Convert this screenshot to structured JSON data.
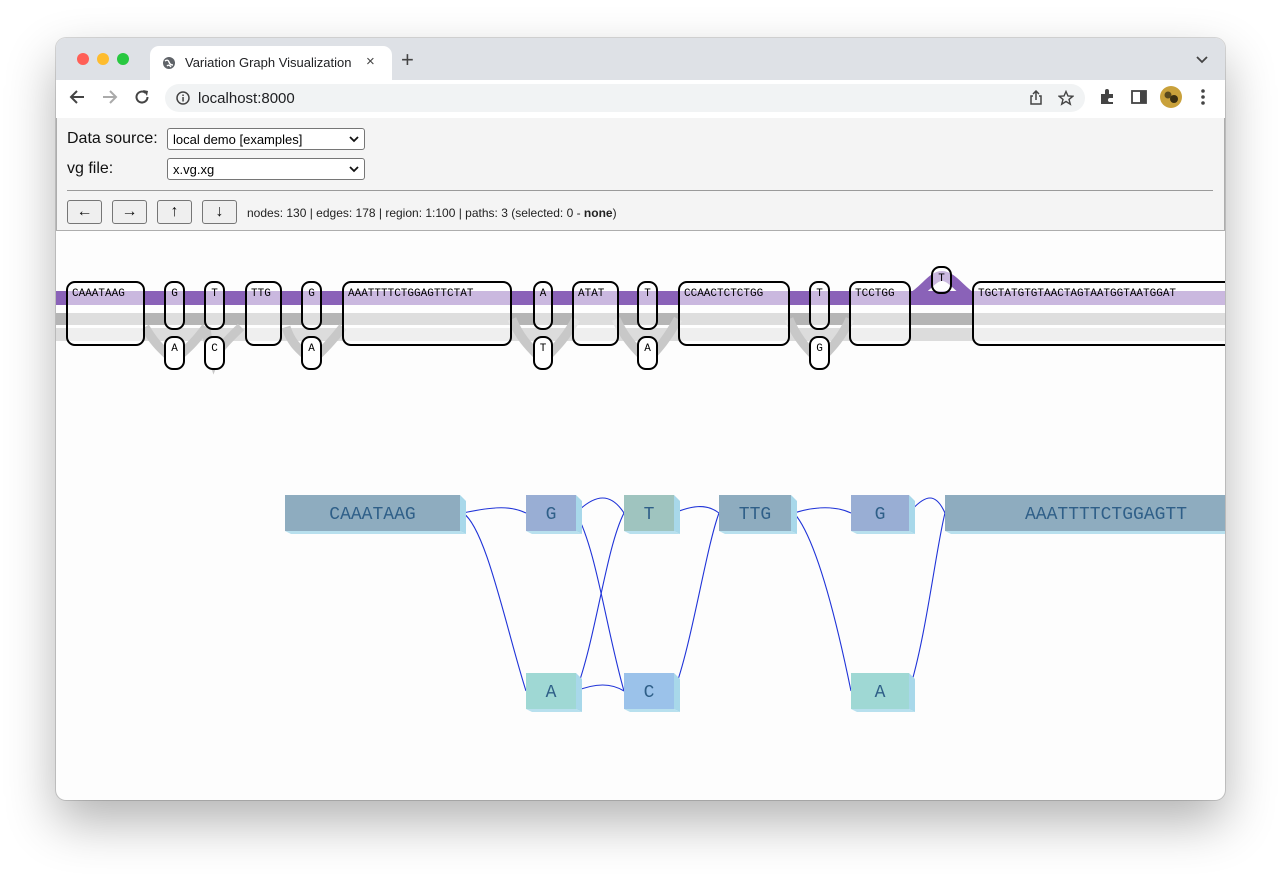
{
  "browser": {
    "tab_title": "Variation Graph Visualization",
    "url": "localhost:8000",
    "new_tab": "+",
    "close_tab": "×"
  },
  "controls": {
    "data_source_label": "Data source:",
    "data_source_value": "local demo [examples]",
    "vg_file_label": "vg file:",
    "vg_file_value": "x.vg.xg",
    "buttons": {
      "left": "←",
      "right": "→",
      "up": "↑",
      "down": "↓"
    },
    "stats_text": "nodes: 130 | edges: 178 | region: 1:100 | paths: 3 (selected: 0 - ",
    "stats_selected": "none",
    "stats_close": ")"
  },
  "tube_map": {
    "top_nodes": [
      {
        "seq": "CAAATAAG"
      },
      {
        "seq": "G"
      },
      {
        "seq": "T"
      },
      {
        "seq": "TTG"
      },
      {
        "seq": "G"
      },
      {
        "seq": "AAATTTTCTGGAGTTCTAT"
      },
      {
        "seq": "A"
      },
      {
        "seq": "ATAT"
      },
      {
        "seq": "T"
      },
      {
        "seq": "CCAACTCTCTGG"
      },
      {
        "seq": "T"
      },
      {
        "seq": "TCCTGG"
      },
      {
        "seq": "T"
      },
      {
        "seq": "TGCTATGTGTAACTAGTAATGGTAATGGAT"
      }
    ],
    "bottom_nodes": [
      {
        "seq": "A"
      },
      {
        "seq": "C"
      },
      {
        "seq": "A"
      },
      {
        "seq": "T"
      },
      {
        "seq": "A"
      },
      {
        "seq": "G"
      }
    ],
    "colors": {
      "selected_path": "#8a62b8",
      "path_dark": "#b0b0b0",
      "path_light": "#d6d6d6"
    }
  },
  "graph3d": {
    "nodes": [
      {
        "seq": "CAAATAAG",
        "color": "#8eacbf"
      },
      {
        "seq": "G",
        "color": "#99aed4"
      },
      {
        "seq": "T",
        "color": "#9fc4bf"
      },
      {
        "seq": "TTG",
        "color": "#8eacbf"
      },
      {
        "seq": "G",
        "color": "#99aed4"
      },
      {
        "seq": "AAATTTTCTGGAGTT",
        "color": "#8eacbf"
      },
      {
        "seq": "A",
        "color": "#9fd8d4"
      },
      {
        "seq": "C",
        "color": "#9bc2ea"
      },
      {
        "seq": "A",
        "color": "#9fd8d4"
      }
    ],
    "edge_color": "#1f33d8",
    "text_color": "#2f5f88"
  }
}
